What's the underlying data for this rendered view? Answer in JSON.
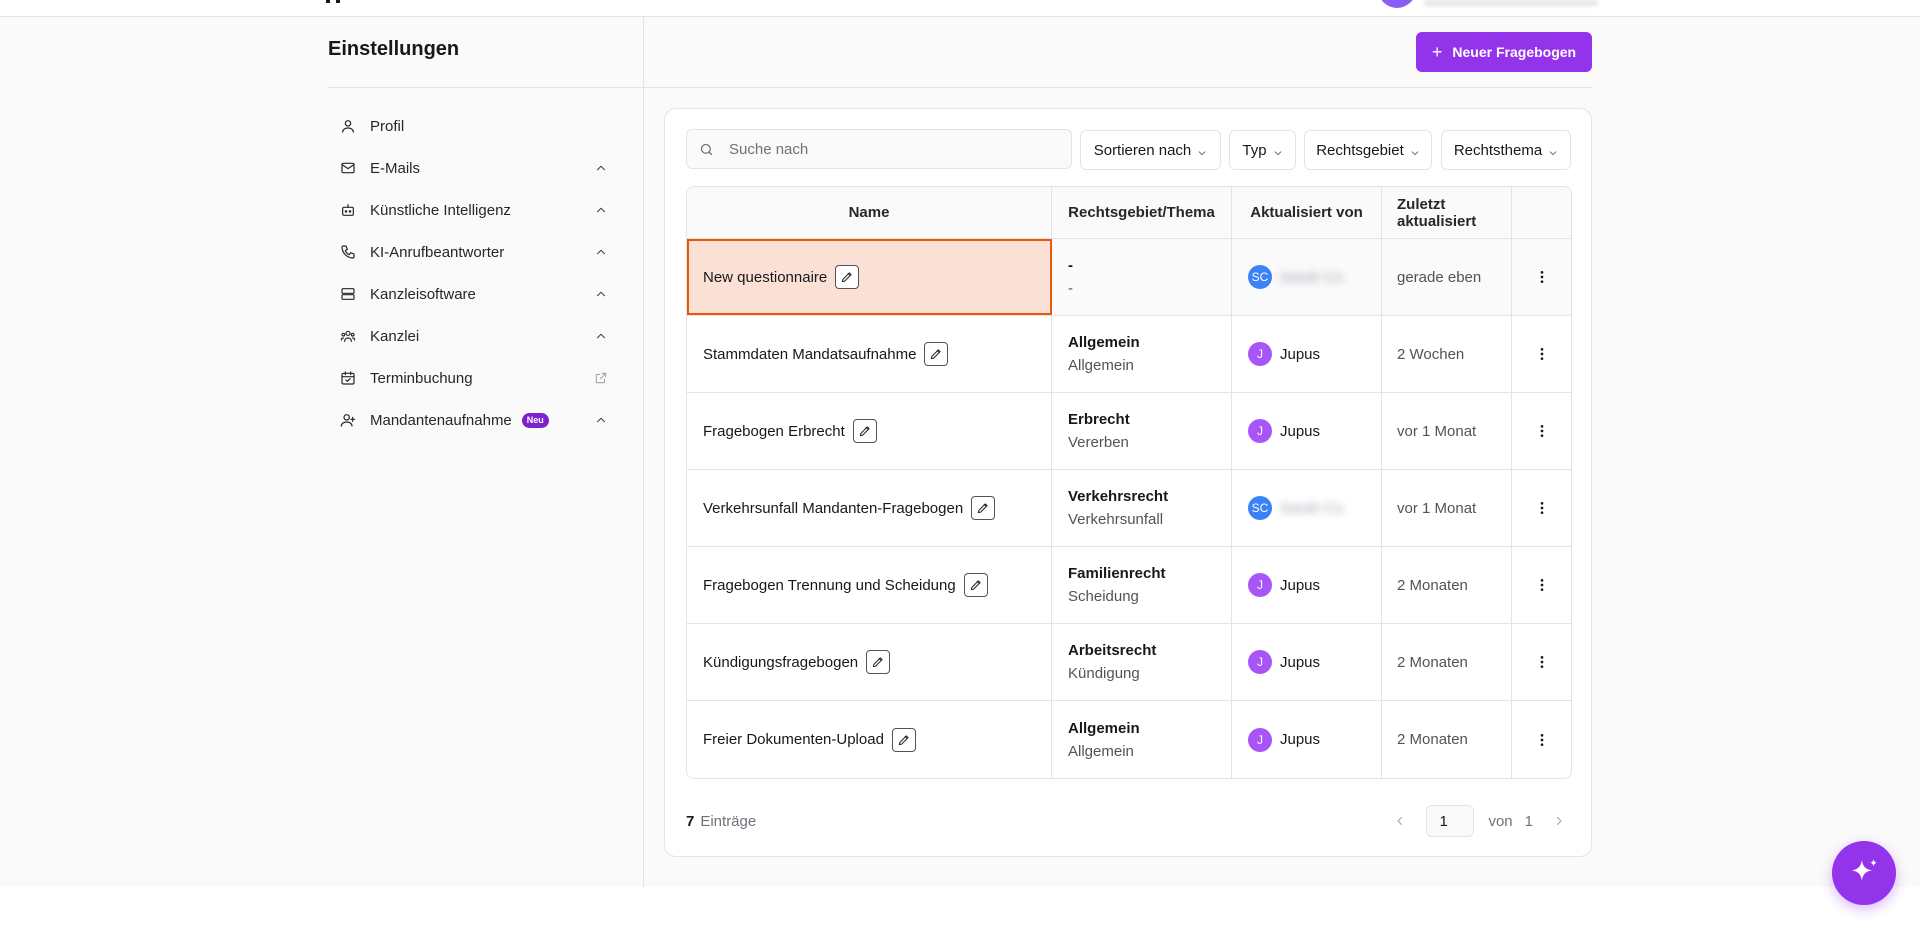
{
  "settings": {
    "title": "Einstellungen"
  },
  "sidebar": {
    "items": [
      {
        "label": "Profil",
        "icon": "user-icon"
      },
      {
        "label": "E-Mails",
        "icon": "mail-icon"
      },
      {
        "label": "Künstliche Intelligenz",
        "icon": "bot-icon"
      },
      {
        "label": "KI-Anrufbeantworter",
        "icon": "phone-icon"
      },
      {
        "label": "Kanzleisoftware",
        "icon": "server-icon"
      },
      {
        "label": "Kanzlei",
        "icon": "team-icon"
      },
      {
        "label": "Terminbuchung",
        "icon": "calendar-icon"
      },
      {
        "label": "Mandantenaufnahme",
        "icon": "user-plus-icon",
        "badge": "Neu"
      }
    ]
  },
  "toolbar": {
    "new_label": "Neuer Fragebogen"
  },
  "search": {
    "placeholder": "Suche nach"
  },
  "filters": {
    "sort": "Sortieren nach",
    "type": "Typ",
    "area": "Rechtsgebiet",
    "topic": "Rechtsthema"
  },
  "table": {
    "headers": {
      "name": "Name",
      "area": "Rechtsgebiet/Thema",
      "updated_by": "Aktualisiert von",
      "last_updated": "Zuletzt aktualisiert"
    },
    "rows": [
      {
        "name": "New questionnaire",
        "area": "-",
        "topic": "-",
        "user_initials": "SC",
        "user_name": "Sarah Co",
        "last": "gerade eben"
      },
      {
        "name": "Stammdaten Mandatsaufnahme",
        "area": "Allgemein",
        "topic": "Allgemein",
        "user_initials": "J",
        "user_name": "Jupus",
        "last": "2 Wochen"
      },
      {
        "name": "Fragebogen Erbrecht",
        "area": "Erbrecht",
        "topic": "Vererben",
        "user_initials": "J",
        "user_name": "Jupus",
        "last": "vor 1 Monat"
      },
      {
        "name": "Verkehrsunfall Mandanten-Fragebogen",
        "area": "Verkehrsrecht",
        "topic": "Verkehrsunfall",
        "user_initials": "SC",
        "user_name": "Sarah Co",
        "last": "vor 1 Monat"
      },
      {
        "name": "Fragebogen Trennung und Scheidung",
        "area": "Familienrecht",
        "topic": "Scheidung",
        "user_initials": "J",
        "user_name": "Jupus",
        "last": "2 Monaten"
      },
      {
        "name": "Kündigungsfragebogen",
        "area": "Arbeitsrecht",
        "topic": "Kündigung",
        "user_initials": "J",
        "user_name": "Jupus",
        "last": "2 Monaten"
      },
      {
        "name": "Freier Dokumenten-Upload",
        "area": "Allgemein",
        "topic": "Allgemein",
        "user_initials": "J",
        "user_name": "Jupus",
        "last": "2 Monaten"
      }
    ]
  },
  "pagination": {
    "count": "7",
    "count_label": "Einträge",
    "page": "1",
    "of_label": "von",
    "total": "1"
  },
  "colors": {
    "accent": "#9333ea",
    "highlight_fill": "#fbe0d6",
    "highlight_border": "#ea580c",
    "avatar_sc": "#3b82f6",
    "avatar_j": "#a855f7"
  }
}
